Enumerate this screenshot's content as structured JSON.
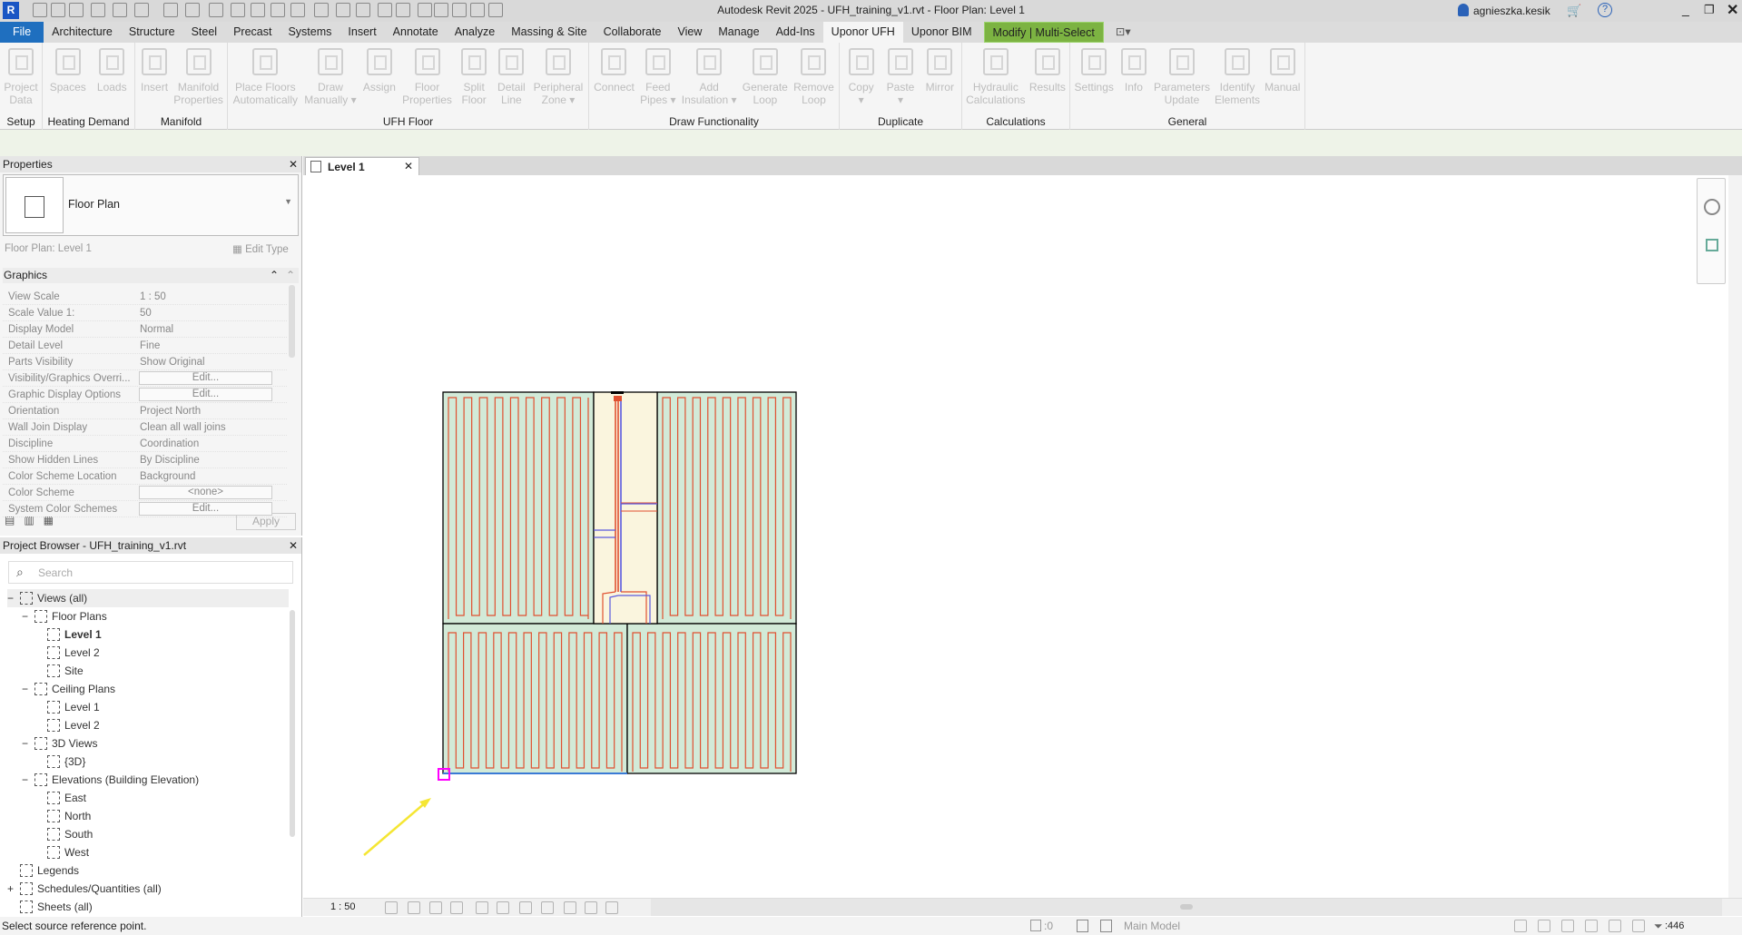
{
  "app": {
    "title": "Autodesk Revit 2025 - UFH_training_v1.rvt - Floor Plan: Level 1",
    "logo": "R",
    "user": "agnieszka.kesik"
  },
  "tabs": [
    "File",
    "Architecture",
    "Structure",
    "Steel",
    "Precast",
    "Systems",
    "Insert",
    "Annotate",
    "Analyze",
    "Massing & Site",
    "Collaborate",
    "View",
    "Manage",
    "Add-Ins",
    "Uponor UFH",
    "Uponor BIM",
    "Modify | Multi-Select"
  ],
  "active_tab": "Uponor UFH",
  "ribbon_groups": [
    {
      "label": "Setup",
      "buttons": [
        "Project\nData"
      ]
    },
    {
      "label": "Heating Demand",
      "buttons": [
        "Spaces",
        "Loads"
      ]
    },
    {
      "label": "Manifold",
      "buttons": [
        "Insert",
        "Manifold\nProperties"
      ]
    },
    {
      "label": "UFH Floor",
      "buttons": [
        "Place Floors\nAutomatically",
        "Draw\nManually ▾",
        "Assign",
        "Floor\nProperties",
        "Split\nFloor",
        "Detail\nLine",
        "Peripheral\nZone ▾"
      ]
    },
    {
      "label": "Draw Functionality",
      "buttons": [
        "Connect",
        "Feed\nPipes ▾",
        "Add\nInsulation ▾",
        "Generate\nLoop",
        "Remove\nLoop"
      ]
    },
    {
      "label": "Duplicate",
      "buttons": [
        "Copy\n▾",
        "Paste\n▾",
        "Mirror"
      ]
    },
    {
      "label": "Calculations",
      "buttons": [
        "Hydraulic\nCalculations",
        "Results"
      ]
    },
    {
      "label": "General",
      "buttons": [
        "Settings",
        "Info",
        "Parameters\nUpdate",
        "Identify\nElements",
        "Manual"
      ]
    }
  ],
  "properties": {
    "title": "Properties",
    "type": "Floor Plan",
    "instance": "Floor Plan: Level 1",
    "edit_type": "Edit Type",
    "section": "Graphics",
    "apply": "Apply",
    "rows": [
      {
        "k": "View Scale",
        "v": "1 : 50"
      },
      {
        "k": "Scale Value    1:",
        "v": "50"
      },
      {
        "k": "Display Model",
        "v": "Normal"
      },
      {
        "k": "Detail Level",
        "v": "Fine"
      },
      {
        "k": "Parts Visibility",
        "v": "Show Original"
      },
      {
        "k": "Visibility/Graphics Overri...",
        "b": "Edit..."
      },
      {
        "k": "Graphic Display Options",
        "b": "Edit..."
      },
      {
        "k": "Orientation",
        "v": "Project North"
      },
      {
        "k": "Wall Join Display",
        "v": "Clean all wall joins"
      },
      {
        "k": "Discipline",
        "v": "Coordination"
      },
      {
        "k": "Show Hidden Lines",
        "v": "By Discipline"
      },
      {
        "k": "Color Scheme Location",
        "v": "Background"
      },
      {
        "k": "Color Scheme",
        "b": "<none>"
      },
      {
        "k": "System Color Schemes",
        "b": "Edit..."
      }
    ]
  },
  "browser": {
    "title": "Project Browser - UFH_training_v1.rvt",
    "search_placeholder": "Search",
    "items": [
      {
        "t": "Views (all)",
        "lvl": 0,
        "exp": "−"
      },
      {
        "t": "Floor Plans",
        "lvl": 1,
        "exp": "−"
      },
      {
        "t": "Level 1",
        "lvl": 2,
        "bold": true
      },
      {
        "t": "Level 2",
        "lvl": 2
      },
      {
        "t": "Site",
        "lvl": 2
      },
      {
        "t": "Ceiling Plans",
        "lvl": 1,
        "exp": "−"
      },
      {
        "t": "Level 1",
        "lvl": 2
      },
      {
        "t": "Level 2",
        "lvl": 2
      },
      {
        "t": "3D Views",
        "lvl": 1,
        "exp": "−"
      },
      {
        "t": "{3D}",
        "lvl": 2
      },
      {
        "t": "Elevations (Building Elevation)",
        "lvl": 1,
        "exp": "−"
      },
      {
        "t": "East",
        "lvl": 2
      },
      {
        "t": "North",
        "lvl": 2
      },
      {
        "t": "South",
        "lvl": 2
      },
      {
        "t": "West",
        "lvl": 2
      },
      {
        "t": "Legends",
        "lvl": 0.7
      },
      {
        "t": "Schedules/Quantities (all)",
        "lvl": 0.7,
        "exp": "+"
      },
      {
        "t": "Sheets (all)",
        "lvl": 0.7
      }
    ]
  },
  "view_tab": "Level 1",
  "view_scale": "1 : 50",
  "status": {
    "message": "Select source reference point.",
    "worksets": ":0",
    "model": "Main Model",
    "filter": ":446"
  },
  "colors": {
    "room": "#d2ead8",
    "corridor": "#faf5de",
    "supply": "#e05030",
    "return": "#5a5adf",
    "marker": "#ff00ff",
    "arrow": "#f5e633",
    "file_tab": "#1f6fbf",
    "modify_tab": "#7cb342"
  }
}
